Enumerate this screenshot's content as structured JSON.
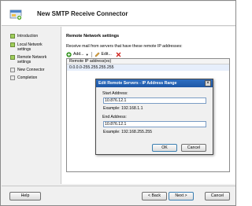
{
  "window": {
    "title": "New SMTP Receive Connector"
  },
  "nav": {
    "items": [
      {
        "label": "Introduction",
        "state": "complete"
      },
      {
        "label": "Local Network settings",
        "state": "complete"
      },
      {
        "label": "Remote Network settings",
        "state": "current"
      },
      {
        "label": "New Connector",
        "state": "pending"
      },
      {
        "label": "Completion",
        "state": "pending"
      }
    ]
  },
  "main": {
    "section_title": "Remote Network settings",
    "description": "Receive mail from servers that have these remote IP addresses:",
    "toolbar": {
      "add_label": "Add...",
      "edit_label": "Edit...",
      "add_icon": "plus-icon",
      "edit_icon": "pencil-icon",
      "delete_icon": "delete-x-icon"
    },
    "list": {
      "column_header": "Remote IP address(es)",
      "rows": [
        "0.0.0.0-255.255.255.255"
      ]
    }
  },
  "footer": {
    "help_label": "Help",
    "back_label": "< Back",
    "next_label": "Next >",
    "cancel_label": "Cancel"
  },
  "dialog": {
    "title": "Edit Remote Servers - IP Address Range",
    "close_glyph": "×",
    "start_label": "Start Address:",
    "start_value": "10.876.12.1",
    "start_example": "Example: 192.168.1.1",
    "end_label": "End Address:",
    "end_value": "10.876.12.1",
    "end_example": "Example: 192.168.255.255",
    "ok_label": "OK",
    "cancel_label": "Cancel"
  },
  "colors": {
    "dialog_title_bg": "#1d57a6",
    "nav_complete": "#9fcf5a",
    "selection": "#e6eefb"
  }
}
